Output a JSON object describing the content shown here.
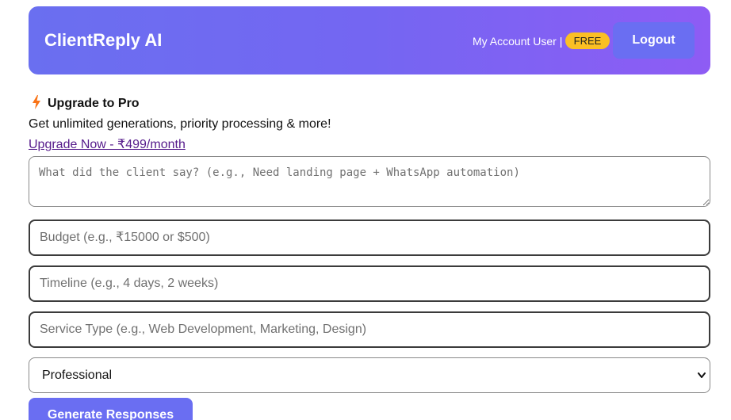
{
  "header": {
    "brand": "ClientReply AI",
    "account_text": "My Account User |",
    "plan_badge": "FREE",
    "logout_label": "Logout"
  },
  "upgrade": {
    "icon": "lightning-bolt-icon",
    "title": "Upgrade to Pro",
    "description": "Get unlimited generations, priority processing & more!",
    "link_text": "Upgrade Now - ₹499/month"
  },
  "form": {
    "client_message": {
      "value": "",
      "placeholder": "What did the client say? (e.g., Need landing page + WhatsApp automation)"
    },
    "budget": {
      "value": "",
      "placeholder": "Budget (e.g., ₹15000 or $500)"
    },
    "timeline": {
      "value": "",
      "placeholder": "Timeline (e.g., 4 days, 2 weeks)"
    },
    "service_type": {
      "value": "",
      "placeholder": "Service Type (e.g., Web Development, Marketing, Design)"
    },
    "tone": {
      "selected": "Professional",
      "icon": "chevron-down-icon"
    },
    "generate_label": "Generate Responses"
  },
  "colors": {
    "header_gradient_start": "#6a6ff0",
    "header_gradient_end": "#8e5cf4",
    "badge": "#fbbf24",
    "button": "#6a6ef2",
    "bolt": "#f97316",
    "link": "#551a8b"
  }
}
